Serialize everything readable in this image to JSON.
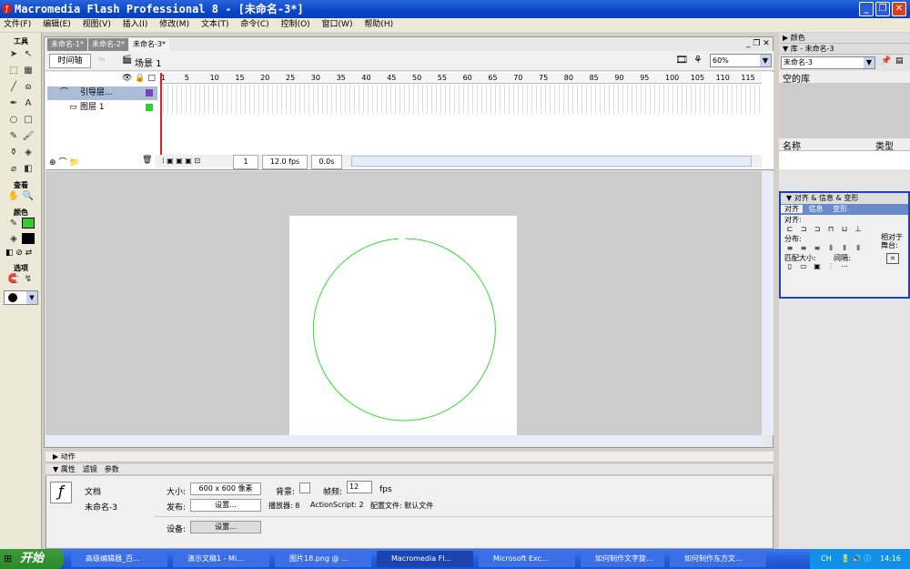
{
  "window": {
    "title": "Macromedia Flash Professional 8 - [未命名-3*]"
  },
  "menu": [
    "文件(F)",
    "编辑(E)",
    "视图(V)",
    "插入(I)",
    "修改(M)",
    "文本(T)",
    "命令(C)",
    "控制(O)",
    "窗口(W)",
    "帮助(H)"
  ],
  "tools": {
    "title": "工具",
    "view": "查看",
    "colors": "颜色",
    "options": "选项"
  },
  "doc_tabs": [
    "未命名-1*",
    "未命名-2*",
    "未命名-3*"
  ],
  "timeline": {
    "button": "时间轴",
    "scene": "场景 1",
    "zoom": "60%",
    "frame_numbers": [
      "1",
      "5",
      "10",
      "15",
      "20",
      "25",
      "30",
      "35",
      "40",
      "45",
      "50",
      "55",
      "60",
      "65",
      "70",
      "75",
      "80",
      "85",
      "90",
      "95",
      "100",
      "105",
      "110",
      "115"
    ],
    "layers": [
      {
        "name": "引导层..."
      },
      {
        "name": "图层 1"
      }
    ],
    "current_frame": "1",
    "fps": "12.0 fps",
    "time": "0.0s"
  },
  "panels": {
    "actions": "动作",
    "props_tab": "属性",
    "filters_tab": "滤镜",
    "params_tab": "参数"
  },
  "properties": {
    "doc_label": "文档",
    "doc_name": "未命名-3",
    "size_label": "大小:",
    "size_value": "600 x 600 像素",
    "bg_label": "背景:",
    "fps_label": "帧频:",
    "fps_value": "12",
    "fps_unit": "fps",
    "publish_label": "发布:",
    "settings_btn": "设置...",
    "player_label": "播放器: 8",
    "as_label": "ActionScript: 2",
    "profile_label": "配置文件: 默认文件",
    "device_label": "设备:"
  },
  "right_panel": {
    "color": "颜色",
    "library": "库 - 未命名-3",
    "library_select": "未命名-3",
    "empty_lib": "空的库",
    "col_name": "名称",
    "col_type": "类型",
    "align_title": "对齐 & 信息 & 变形",
    "align_tabs": [
      "对齐",
      "信息",
      "变形"
    ],
    "align": "对齐:",
    "distribute": "分布:",
    "match_size": "匹配大小:",
    "spacing": "间隔:",
    "relative": "相对于舞台:"
  },
  "taskbar": {
    "start": "开始",
    "tasks": [
      "高级编辑器_百...",
      "演示文稿1 - Mi...",
      "图片18.png @ ...",
      "Macromedia Fl...",
      "Microsoft Exc...",
      "如何制作文字旋...",
      "如何制作东方文..."
    ],
    "lang": "CH",
    "time": "14:16"
  },
  "colors": {
    "stroke": "#33cc33",
    "circle": "#33dd33",
    "layer1": "#7744bb",
    "layer2": "#33cc33"
  }
}
